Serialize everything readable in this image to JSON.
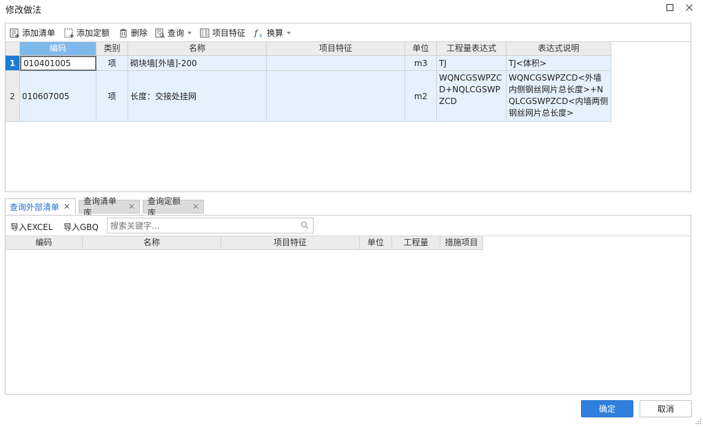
{
  "window": {
    "title": "修改做法",
    "maximize_icon": "maximize-icon",
    "close_icon": "close-icon"
  },
  "toolbar": {
    "items": [
      {
        "label": "添加清单",
        "icon": "add-list-icon"
      },
      {
        "label": "添加定额",
        "icon": "add-quota-icon"
      },
      {
        "label": "删除",
        "icon": "trash-icon"
      },
      {
        "label": "查询",
        "icon": "query-icon",
        "dropdown": true
      },
      {
        "label": "项目特征",
        "icon": "feature-icon"
      },
      {
        "label": "换算",
        "icon": "fx-icon",
        "dropdown": true
      }
    ]
  },
  "main_table": {
    "columns": [
      "编码",
      "类别",
      "名称",
      "项目特征",
      "单位",
      "工程量表达式",
      "表达式说明"
    ],
    "rows": [
      {
        "num": "1",
        "code": "010401005",
        "category": "项",
        "name": "砌块墙[外墙]-200",
        "feature": "",
        "unit": "m3",
        "expr": "TJ",
        "desc": "TJ<体积>"
      },
      {
        "num": "2",
        "code": "010607005",
        "category": "项",
        "name": "长度：交接处挂网",
        "feature": "",
        "unit": "m2",
        "expr": "WQNCGSWPZCD+NQLCGSWPZCD",
        "desc": "WQNCGSWPZCD<外墙内侧钢丝网片总长度>+NQLCGSWPZCD<内墙两侧钢丝网片总长度>"
      }
    ]
  },
  "tabs": [
    {
      "label": "查询外部清单",
      "active": true
    },
    {
      "label": "查询清单库",
      "active": false
    },
    {
      "label": "查询定额库",
      "active": false
    }
  ],
  "lower_tools": {
    "import_excel": "导入EXCEL",
    "import_gbq": "导入GBQ",
    "search_placeholder": "搜索关键字..."
  },
  "lower_table": {
    "columns": [
      "编码",
      "名称",
      "项目特征",
      "单位",
      "工程量",
      "措施项目"
    ]
  },
  "buttons": {
    "ok": "确定",
    "cancel": "取消"
  },
  "colors": {
    "accent": "#2f7fdc",
    "selected_header": "#7fb8ea",
    "row_selected": "#e5f1fc"
  }
}
